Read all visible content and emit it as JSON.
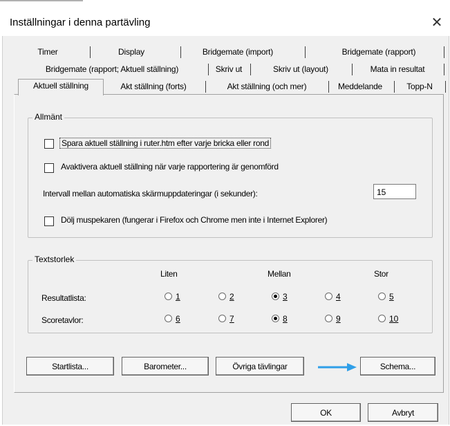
{
  "window": {
    "title": "Inställningar i denna partävling",
    "close_glyph": "✕"
  },
  "tabs": {
    "row1": [
      "Timer",
      "Display",
      "Bridgemate (import)",
      "Bridgemate (rapport)"
    ],
    "row2": [
      "Bridgemate (rapport; Aktuell ställning)",
      "Skriv ut",
      "Skriv ut (layout)",
      "Mata in resultat"
    ],
    "row3": [
      "Aktuell ställning",
      "Akt ställning (forts)",
      "Akt ställning (och mer)",
      "Meddelande",
      "Topp-N"
    ],
    "active": "Aktuell ställning"
  },
  "general": {
    "title": "Allmänt",
    "save_label": "Spara aktuell ställning i ruter.htm efter varje bricka eller rond",
    "save_checked": false,
    "deactivate_label": "Avaktivera aktuell ställning när varje rapportering är genomförd",
    "deactivate_checked": false,
    "interval_label": "Intervall mellan automatiska skärmuppdateringar (i sekunder):",
    "interval_value": "15",
    "hide_pointer_label": "Dölj muspekaren (fungerar i Firefox och Chrome men inte i Internet Explorer)",
    "hide_pointer_checked": false
  },
  "textsize": {
    "title": "Textstorlek",
    "col_small": "Liten",
    "col_medium": "Mellan",
    "col_large": "Stor",
    "row_results": "Resultatlista:",
    "row_scoreboards": "Scoretavlor:",
    "results_options": [
      "1",
      "2",
      "3",
      "4",
      "5"
    ],
    "results_selected": "3",
    "scoreboard_options": [
      "6",
      "7",
      "8",
      "9",
      "10"
    ],
    "scoreboard_selected": "8"
  },
  "buttons": {
    "startlist": "Startlista...",
    "barometer": "Barometer...",
    "other_competitions": "Övriga tävlingar",
    "schedule": "Schema...",
    "ok": "OK",
    "cancel": "Avbryt"
  },
  "annotation": {
    "arrow_color": "#2f9fe8"
  }
}
